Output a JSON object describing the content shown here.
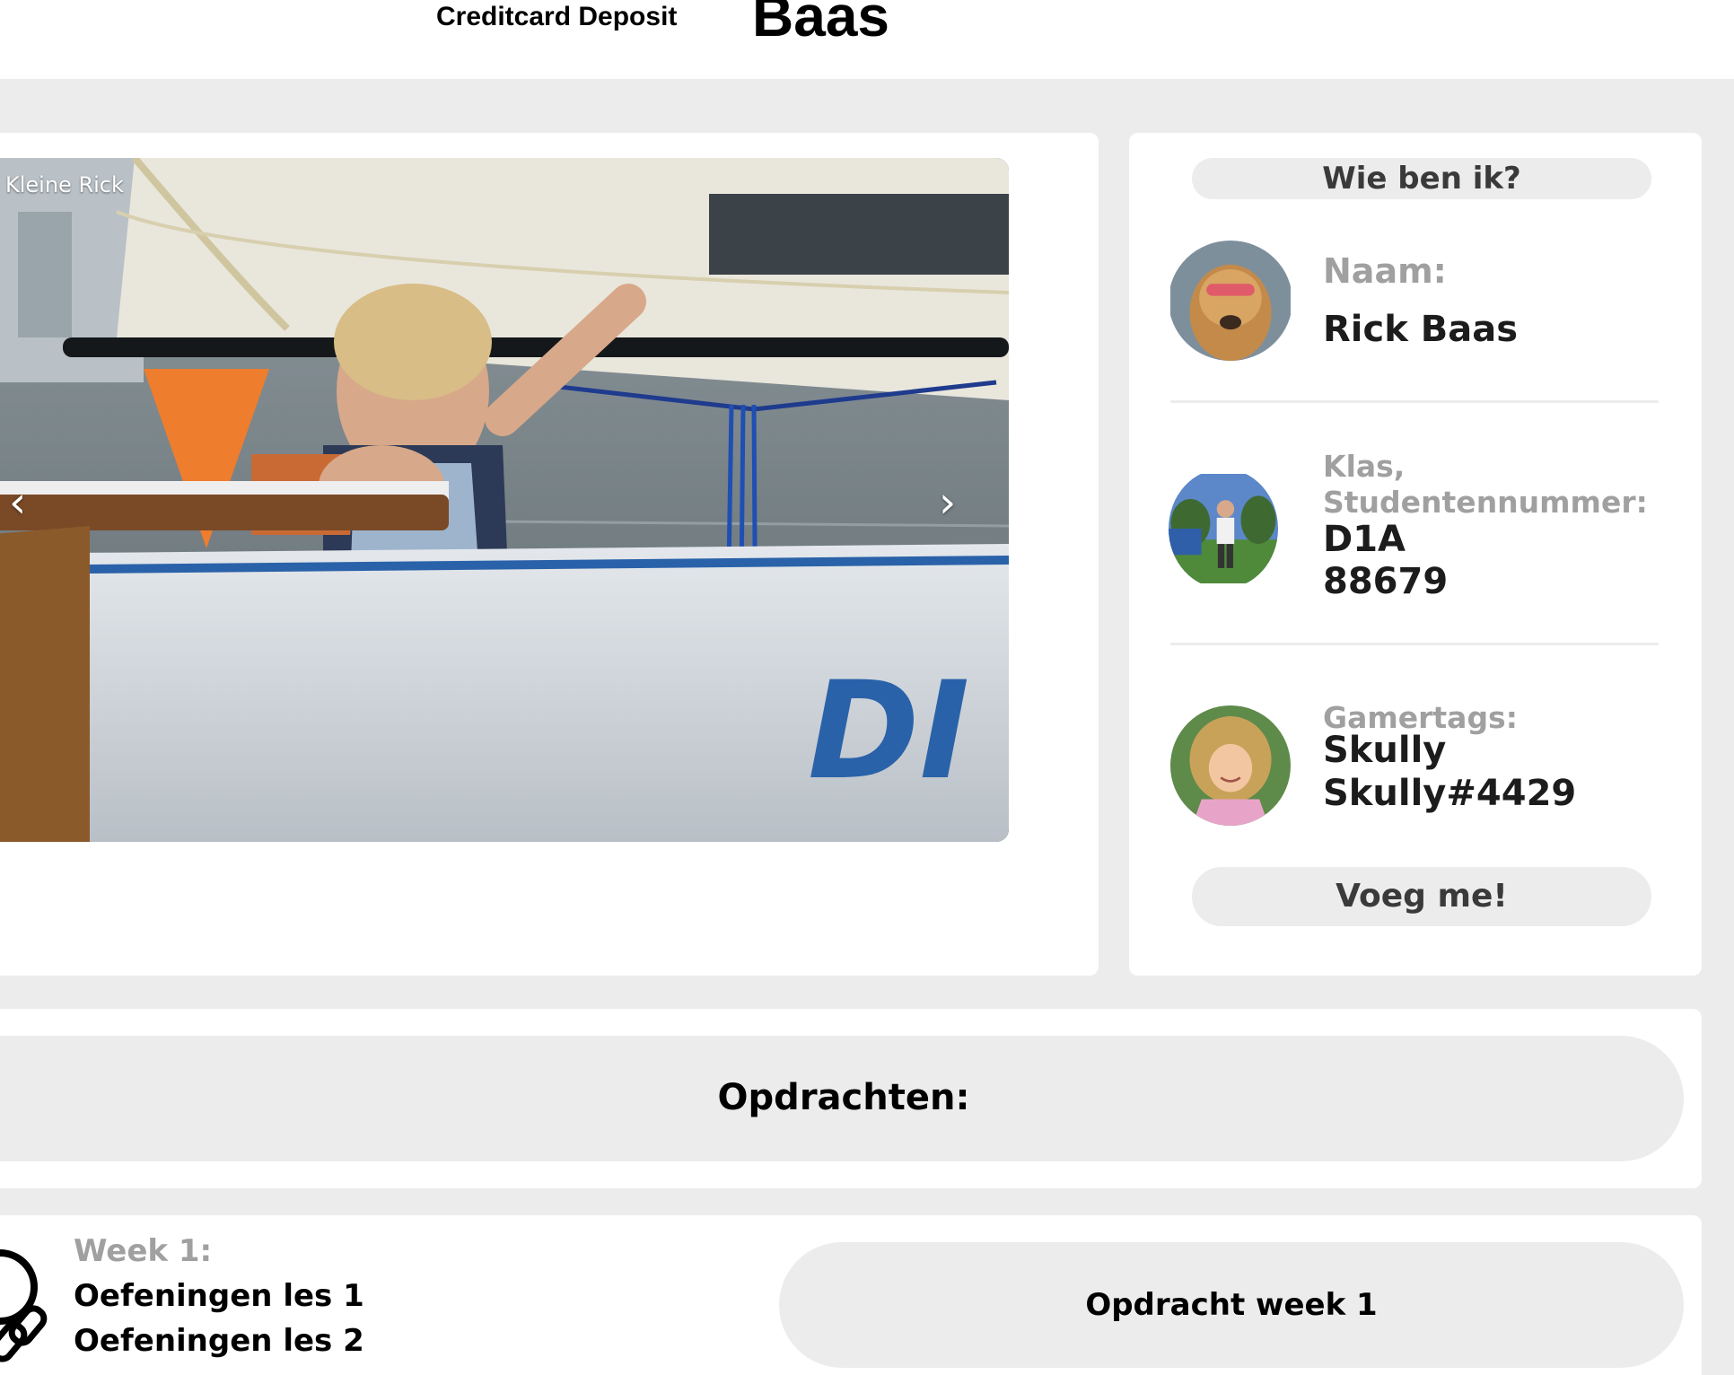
{
  "header": {
    "deposit_link": "Creditcard Deposit",
    "brand": "Baas"
  },
  "slider": {
    "caption": "Kleine Rick",
    "prev_label": "‹",
    "next_label": "›"
  },
  "profile": {
    "who_button": "Wie ben ik?",
    "name_label": "Naam:",
    "name_value": "Rick Baas",
    "class_label": "Klas, Studentennummer:",
    "class_value": "D1A",
    "student_number": "88679",
    "gamertags_label": "Gamertags:",
    "gamertag_1": "Skully",
    "gamertag_2": "Skully#4429",
    "add_button": "Voeg me!"
  },
  "assignments": {
    "title": "Opdrachten:"
  },
  "week": {
    "label": "Week 1:",
    "items": [
      "Oefeningen les 1",
      "Oefeningen les 2"
    ],
    "button": "Opdracht week 1"
  },
  "colors": {
    "background": "#ececec",
    "card": "#ffffff",
    "muted_label": "#a0a0a0",
    "pill": "#ececec"
  }
}
